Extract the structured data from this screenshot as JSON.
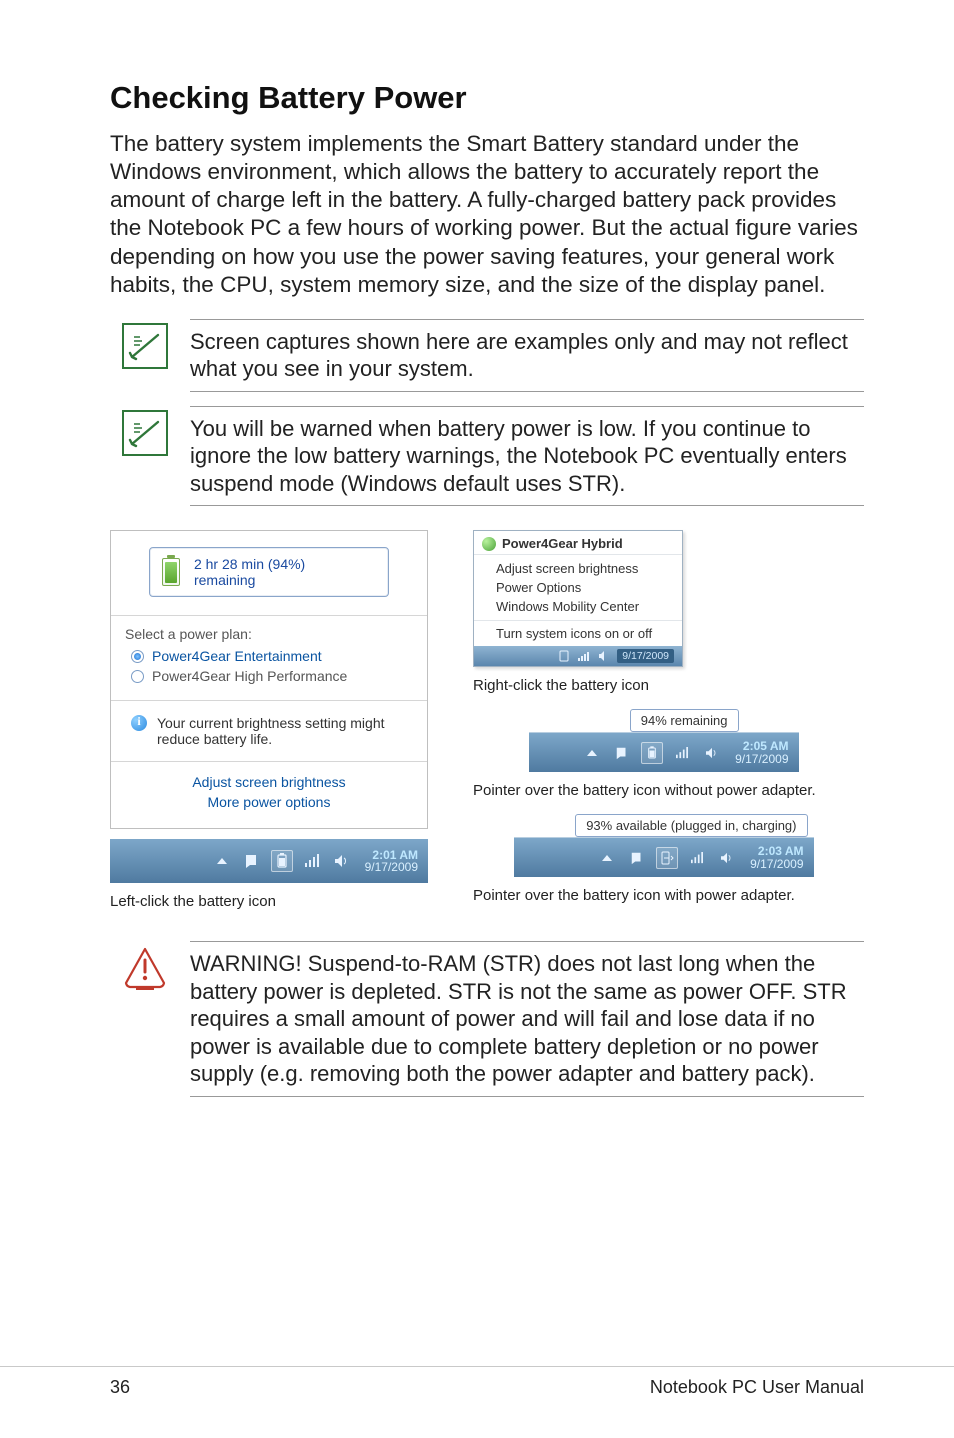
{
  "section": {
    "title": "Checking Battery Power"
  },
  "body_text": "The battery system implements the Smart Battery standard under the Windows environment, which allows the battery to accurately report the amount of charge left in the battery. A fully-charged battery pack provides the Notebook PC a few hours of working power. But the actual figure varies depending on how you use the power saving features, your general work habits, the CPU, system memory size, and the size of the display panel.",
  "notes": {
    "n1": "Screen captures shown here are examples only and may not reflect what you see in your system.",
    "n2": "You will be warned when battery power is low. If you continue to ignore the low battery warnings, the Notebook PC eventually enters suspend mode (Windows default uses STR).",
    "warn": "WARNING!  Suspend-to-RAM (STR) does not last long when the battery power is depleted. STR is not the same as power OFF. STR requires a small amount of power and will fail and lose data if no power is available due to complete battery depletion or no power supply (e.g. removing both the power adapter and battery pack)."
  },
  "battery_panel": {
    "remaining": "2 hr 28 min (94%) remaining",
    "plan_label": "Select a power plan:",
    "plan1": "Power4Gear Entertainment",
    "plan2": "Power4Gear High Performance",
    "info": "Your current brightness setting might reduce battery life.",
    "link1": "Adjust screen brightness",
    "link2": "More power options"
  },
  "taskbar1": {
    "time": "2:01 AM",
    "date": "9/17/2009"
  },
  "caption_left": "Left-click the battery icon",
  "context_menu": {
    "title": "Power4Gear Hybrid",
    "i1": "Adjust screen brightness",
    "i2": "Power Options",
    "i3": "Windows Mobility Center",
    "i4": "Turn system icons on or off",
    "date": "9/17/2009"
  },
  "caption_r1": "Right-click the battery icon",
  "tooltip_r2": "94% remaining",
  "taskbar_r2": {
    "time": "2:05 AM",
    "date": "9/17/2009"
  },
  "caption_r2": "Pointer over the battery icon without power adapter.",
  "tooltip_r3": "93% available (plugged in, charging)",
  "taskbar_r3": {
    "time": "2:03 AM",
    "date": "9/17/2009"
  },
  "caption_r3": "Pointer over the battery icon with power adapter.",
  "footer": {
    "page": "36",
    "manual": "Notebook PC User Manual"
  }
}
